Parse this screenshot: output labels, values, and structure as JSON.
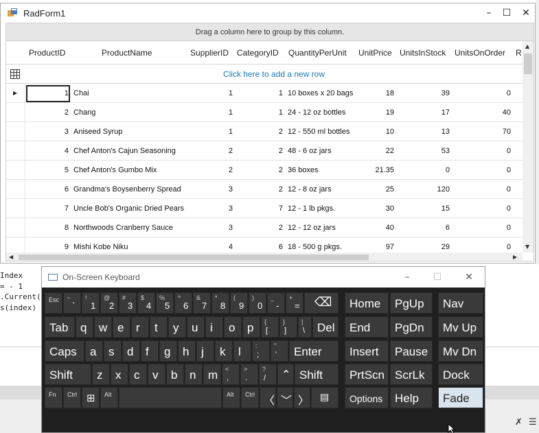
{
  "ide": {
    "code_lines": [
      "Index",
      "= - 1",
      ".Current(",
      "s(index)"
    ]
  },
  "radform": {
    "title": "RadForm1",
    "group_panel_text": "Drag a column here to group by this column.",
    "new_row_text": "Click here to add a new row",
    "columns": [
      "ProductID",
      "ProductName",
      "SupplierID",
      "CategoryID",
      "QuantityPerUnit",
      "UnitPrice",
      "UnitsInStock",
      "UnitsOnOrder",
      "R"
    ],
    "rows": [
      {
        "id": "1",
        "name": "Chai",
        "supplier": "1",
        "category": "1",
        "qty": "10 boxes x 20 bags",
        "price": "18",
        "stock": "39",
        "order": "0"
      },
      {
        "id": "2",
        "name": "Chang",
        "supplier": "1",
        "category": "1",
        "qty": "24 - 12 oz bottles",
        "price": "19",
        "stock": "17",
        "order": "40"
      },
      {
        "id": "3",
        "name": "Aniseed Syrup",
        "supplier": "1",
        "category": "2",
        "qty": "12 - 550 ml bottles",
        "price": "10",
        "stock": "13",
        "order": "70"
      },
      {
        "id": "4",
        "name": "Chef Anton's Cajun Seasoning",
        "supplier": "2",
        "category": "2",
        "qty": "48 - 6 oz jars",
        "price": "22",
        "stock": "53",
        "order": "0"
      },
      {
        "id": "5",
        "name": "Chef Anton's Gumbo Mix",
        "supplier": "2",
        "category": "2",
        "qty": "36 boxes",
        "price": "21.35",
        "stock": "0",
        "order": "0"
      },
      {
        "id": "6",
        "name": "Grandma's Boysenberry Spread",
        "supplier": "3",
        "category": "2",
        "qty": "12 - 8 oz jars",
        "price": "25",
        "stock": "120",
        "order": "0"
      },
      {
        "id": "7",
        "name": "Uncle Bob's Organic Dried Pears",
        "supplier": "3",
        "category": "7",
        "qty": "12 - 1 lb pkgs.",
        "price": "30",
        "stock": "15",
        "order": "0"
      },
      {
        "id": "8",
        "name": "Northwoods Cranberry Sauce",
        "supplier": "3",
        "category": "2",
        "qty": "12 - 12 oz jars",
        "price": "40",
        "stock": "6",
        "order": "0"
      },
      {
        "id": "9",
        "name": "Mishi Kobe Niku",
        "supplier": "4",
        "category": "6",
        "qty": "18 - 500 g pkgs.",
        "price": "97",
        "stock": "29",
        "order": "0"
      }
    ]
  },
  "osk": {
    "title": "On-Screen Keyboard",
    "keys": {
      "esc": "Esc",
      "n1": [
        "!",
        "1"
      ],
      "n2": [
        "@",
        "2"
      ],
      "n3": [
        "#",
        "3"
      ],
      "n4": [
        "$",
        "4"
      ],
      "n5": [
        "%",
        "5"
      ],
      "n6": [
        "^",
        "6"
      ],
      "n7": [
        "&",
        "7"
      ],
      "n8": [
        "*",
        "8"
      ],
      "n9": [
        "(",
        "9"
      ],
      "n0": [
        ")",
        "0"
      ],
      "tilde": [
        "~",
        "`"
      ],
      "minus": [
        "_",
        "-"
      ],
      "plus": [
        "+",
        "="
      ],
      "tab": "Tab",
      "q": "q",
      "w": "w",
      "e": "e",
      "r": "r",
      "t": "t",
      "y": "y",
      "u": "u",
      "i": "i",
      "o": "o",
      "p": "p",
      "lbr": [
        "{",
        "["
      ],
      "rbr": [
        "}",
        "]"
      ],
      "pipe": [
        "|",
        "\\"
      ],
      "del": "Del",
      "caps": "Caps",
      "a": "a",
      "s": "s",
      "d": "d",
      "f": "f",
      "g": "g",
      "h": "h",
      "j": "j",
      "k": "k",
      "l": "l",
      "semi": [
        ":",
        ";"
      ],
      "quote": [
        "\"",
        "'"
      ],
      "enter": "Enter",
      "shift": "Shift",
      "z": "z",
      "x": "x",
      "c": "c",
      "v": "v",
      "b": "b",
      "n": "n",
      "m": "m",
      "comma": [
        "<",
        ","
      ],
      "period": [
        ">",
        "."
      ],
      "slash": [
        "?",
        "/"
      ],
      "shift2": "Shift",
      "fn": "Fn",
      "ctrl": "Ctrl",
      "alt": "Alt",
      "alt2": "Alt",
      "ctrl2": "Ctrl",
      "home": "Home",
      "pgup": "PgUp",
      "nav": "Nav",
      "end": "End",
      "pgdn": "PgDn",
      "mvup": "Mv Up",
      "insert": "Insert",
      "pause": "Pause",
      "mvdn": "Mv Dn",
      "prtscn": "PrtScn",
      "scrlk": "ScrLk",
      "dock": "Dock",
      "options": "Options",
      "help": "Help",
      "fade": "Fade"
    }
  }
}
